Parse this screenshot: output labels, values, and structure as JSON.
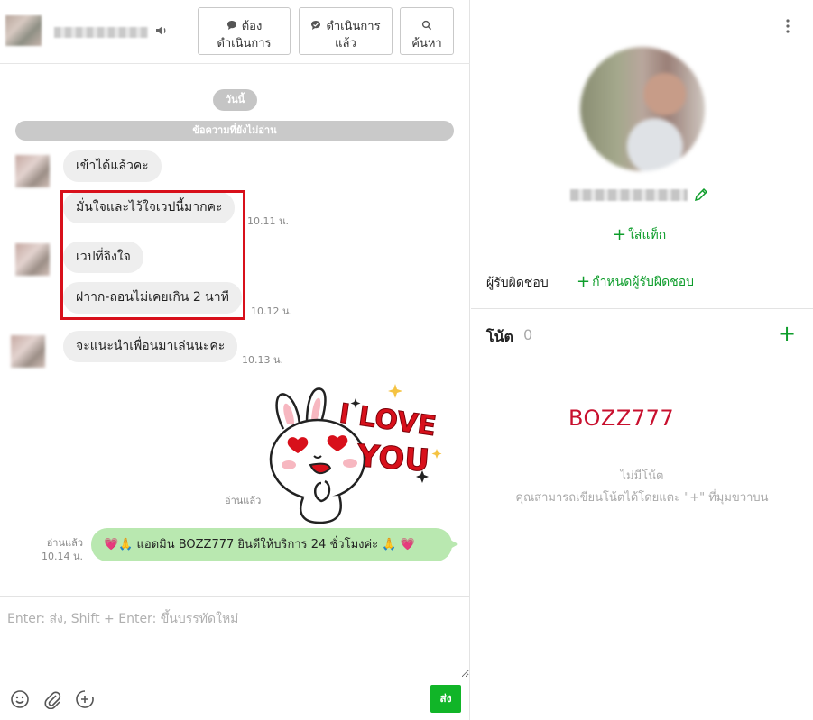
{
  "header": {
    "buttons": {
      "todo": "ต้อง\nดำเนินการ",
      "done": "ดำเนินการ\nแล้ว",
      "search": "ค้นหา"
    }
  },
  "messages": {
    "today": "วันนี้",
    "unread": "ข้อความที่ยังไม่อ่าน",
    "items": [
      {
        "text": "เข้าได้แล้วคะ"
      },
      {
        "text": "มั่นใจและไว้ใจเวปนี้มากคะ",
        "time": "10.11 น."
      },
      {
        "text": "เวปที่จิงใจ"
      },
      {
        "text": "ฝาาก-ถอนไม่เคยเกิน 2 นาที",
        "time": "10.12 น."
      },
      {
        "text": "จะแนะนำเพื่อนมาเล่นนะคะ",
        "time": "10.13 น."
      }
    ],
    "sticker": {
      "read": "อ่านแล้ว",
      "text_line1": "I LOVE",
      "text_line2": "YOU"
    },
    "outgoing": {
      "text": "💗🙏 แอดมิน BOZZ777 ยินดีให้บริการ 24 ชั่วโมงค่ะ 🙏 💗",
      "read": "อ่านแล้ว",
      "time": "10.14 น."
    }
  },
  "composer": {
    "placeholder": "Enter: ส่ง, Shift + Enter: ขึ้นบรรทัดใหม่",
    "send": "ส่ง"
  },
  "profile": {
    "add_tag": "ใส่แท็ก",
    "responsible_label": "ผู้รับผิดชอบ",
    "set_responsible": "กำหนดผู้รับผิดชอบ",
    "note_label": "โน้ต",
    "note_count": "0",
    "note_add": "+",
    "brand_note": "BOZZ777",
    "empty_title": "ไม่มีโน้ต",
    "empty_desc": "คุณสามารถเขียนโน้ตได้โดยแตะ \"+\" ที่มุมขวาบน"
  },
  "colors": {
    "accent_green": "#0e9d2b",
    "send_green": "#11b528",
    "outgoing_bubble": "#b9e8b0",
    "highlight_red": "#d8101b",
    "brand_red": "#c8102e"
  },
  "icons": [
    "speaker-icon",
    "chat-icon",
    "chat-check-icon",
    "search-icon",
    "emoji-icon",
    "attach-icon",
    "add-circle-icon",
    "more-vertical-icon",
    "pencil-icon"
  ]
}
